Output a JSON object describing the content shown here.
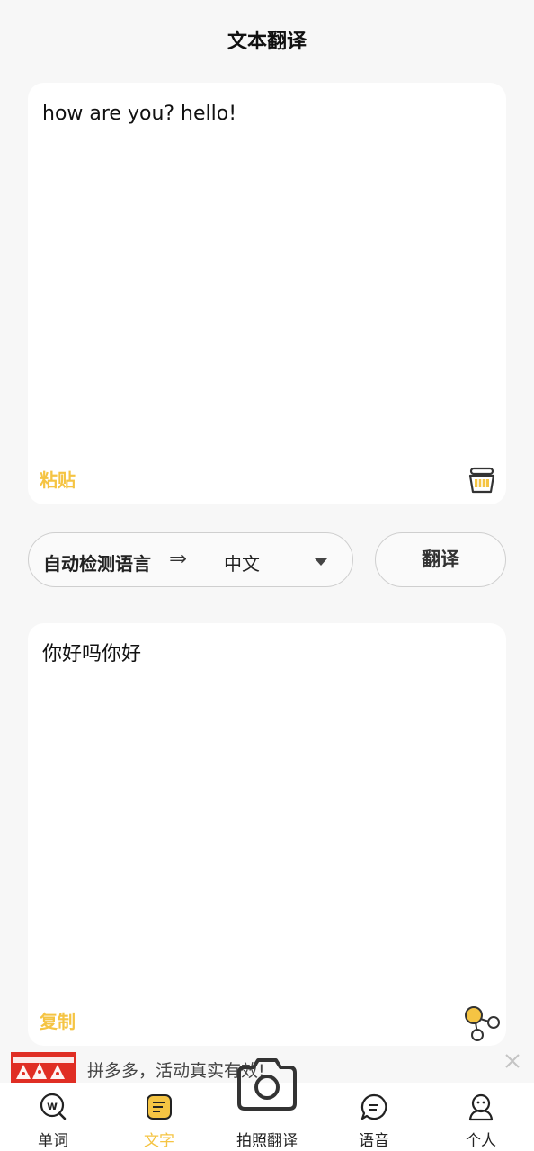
{
  "header": {
    "title": "文本翻译"
  },
  "input_card": {
    "text": "how are you? hello!",
    "paste_label": "粘贴",
    "clear_icon": "basket-icon"
  },
  "language": {
    "source": "自动检测语言",
    "arrow": "⇒",
    "target": "中文"
  },
  "translate_button": {
    "label": "翻译"
  },
  "output_card": {
    "text": "你好吗你好",
    "copy_label": "复制",
    "share_icon": "share-icon"
  },
  "ad": {
    "text": "拼多多，活动真实有效!",
    "close_icon": "close-icon"
  },
  "tabs": [
    {
      "label": "单词",
      "icon": "word-search-icon",
      "active": false
    },
    {
      "label": "文字",
      "icon": "text-doc-icon",
      "active": true
    },
    {
      "label": "拍照翻译",
      "icon": "camera-icon",
      "active": false
    },
    {
      "label": "语音",
      "icon": "speech-bubble-icon",
      "active": false
    },
    {
      "label": "个人",
      "icon": "person-icon",
      "active": false
    }
  ],
  "colors": {
    "accent": "#f5c443",
    "background": "#f7f7f7",
    "ad_brand": "#e02e24"
  }
}
